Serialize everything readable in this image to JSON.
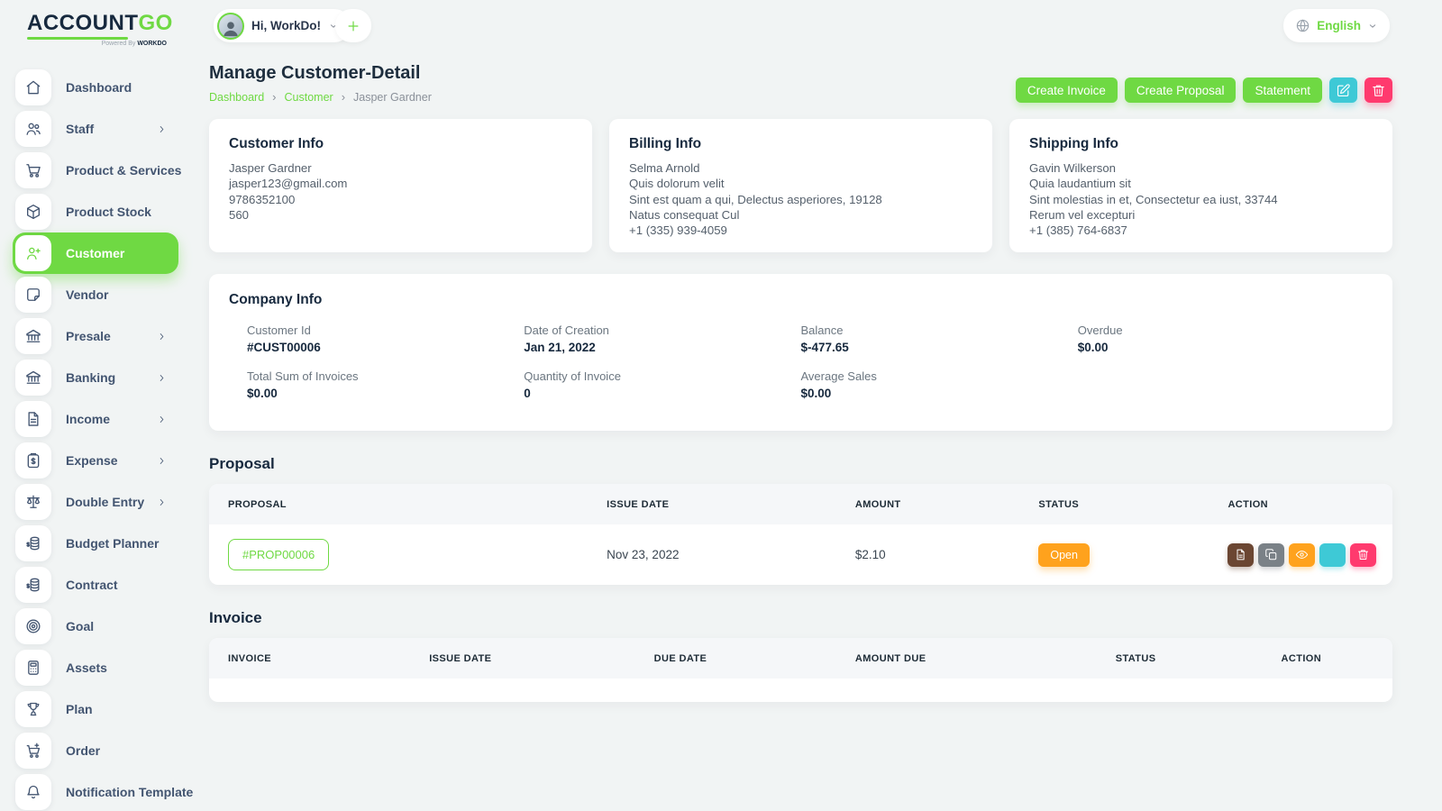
{
  "brand": {
    "name_primary": "ACCOUNT",
    "name_accent": "GO",
    "tagline_prefix": "Powered By",
    "tagline_brand": "WORKDO"
  },
  "header": {
    "greeting": "Hi, WorkDo!",
    "language": "English"
  },
  "sidebar": {
    "items": [
      {
        "label": "Dashboard",
        "icon": "home",
        "active": false,
        "chevron": false
      },
      {
        "label": "Staff",
        "icon": "users",
        "active": false,
        "chevron": true
      },
      {
        "label": "Product & Services",
        "icon": "cart",
        "active": false,
        "chevron": false
      },
      {
        "label": "Product Stock",
        "icon": "box",
        "active": false,
        "chevron": false
      },
      {
        "label": "Customer",
        "icon": "user-plus",
        "active": true,
        "chevron": false
      },
      {
        "label": "Vendor",
        "icon": "note",
        "active": false,
        "chevron": false
      },
      {
        "label": "Presale",
        "icon": "bank",
        "active": false,
        "chevron": true
      },
      {
        "label": "Banking",
        "icon": "bank",
        "active": false,
        "chevron": true
      },
      {
        "label": "Income",
        "icon": "file-text",
        "active": false,
        "chevron": true
      },
      {
        "label": "Expense",
        "icon": "clipboard-dollar",
        "active": false,
        "chevron": true
      },
      {
        "label": "Double Entry",
        "icon": "scales",
        "active": false,
        "chevron": true
      },
      {
        "label": "Budget Planner",
        "icon": "coins",
        "active": false,
        "chevron": false
      },
      {
        "label": "Contract",
        "icon": "coins",
        "active": false,
        "chevron": false
      },
      {
        "label": "Goal",
        "icon": "target",
        "active": false,
        "chevron": false
      },
      {
        "label": "Assets",
        "icon": "calculator",
        "active": false,
        "chevron": false
      },
      {
        "label": "Plan",
        "icon": "trophy",
        "active": false,
        "chevron": false
      },
      {
        "label": "Order",
        "icon": "cart-plus",
        "active": false,
        "chevron": false
      },
      {
        "label": "Notification Template",
        "icon": "bell",
        "active": false,
        "chevron": false
      }
    ]
  },
  "page": {
    "title": "Manage Customer-Detail",
    "breadcrumb": [
      "Dashboard",
      "Customer",
      "Jasper Gardner"
    ]
  },
  "actions": {
    "create_invoice": "Create Invoice",
    "create_proposal": "Create Proposal",
    "statement": "Statement"
  },
  "cards": {
    "customer_info": {
      "title": "Customer Info",
      "lines": [
        "Jasper Gardner",
        "jasper123@gmail.com",
        "9786352100",
        "560"
      ]
    },
    "billing_info": {
      "title": "Billing Info",
      "lines": [
        "Selma Arnold",
        "Quis dolorum velit",
        "Sint est quam a qui, Delectus asperiores, 19128",
        "Natus consequat Cul",
        "+1 (335) 939-4059"
      ]
    },
    "shipping_info": {
      "title": "Shipping Info",
      "lines": [
        "Gavin Wilkerson",
        "Quia laudantium sit",
        "Sint molestias in et, Consectetur ea iust, 33744",
        "Rerum vel excepturi",
        "+1 (385) 764-6837"
      ]
    }
  },
  "company_info": {
    "title": "Company Info",
    "fields": [
      {
        "label": "Customer Id",
        "value": "#CUST00006"
      },
      {
        "label": "Total Sum of Invoices",
        "value": "$0.00"
      },
      {
        "label": "Date of Creation",
        "value": "Jan 21, 2022"
      },
      {
        "label": "Quantity of Invoice",
        "value": "0"
      },
      {
        "label": "Balance",
        "value": "$-477.65"
      },
      {
        "label": "Average Sales",
        "value": "$0.00"
      },
      {
        "label": "Overdue",
        "value": "$0.00"
      }
    ]
  },
  "proposal": {
    "title": "Proposal",
    "columns": [
      "PROPOSAL",
      "ISSUE DATE",
      "AMOUNT",
      "STATUS",
      "ACTION"
    ],
    "rows": [
      {
        "id": "#PROP00006",
        "issue_date": "Nov 23, 2022",
        "amount": "$2.10",
        "status": "Open",
        "actions": [
          "file",
          "copy",
          "eye",
          "edit",
          "trash"
        ]
      }
    ]
  },
  "invoice": {
    "title": "Invoice",
    "columns": [
      "INVOICE",
      "ISSUE DATE",
      "DUE DATE",
      "AMOUNT DUE",
      "STATUS",
      "ACTION"
    ],
    "rows": []
  },
  "colors": {
    "accent": "#6fd943",
    "edit": "#3ec9d6",
    "delete": "#ff3a6e",
    "open_badge": "#ffa21d",
    "action_file": "#6b4632",
    "action_copy": "#7a8187",
    "action_eye": "#ffa21d"
  }
}
